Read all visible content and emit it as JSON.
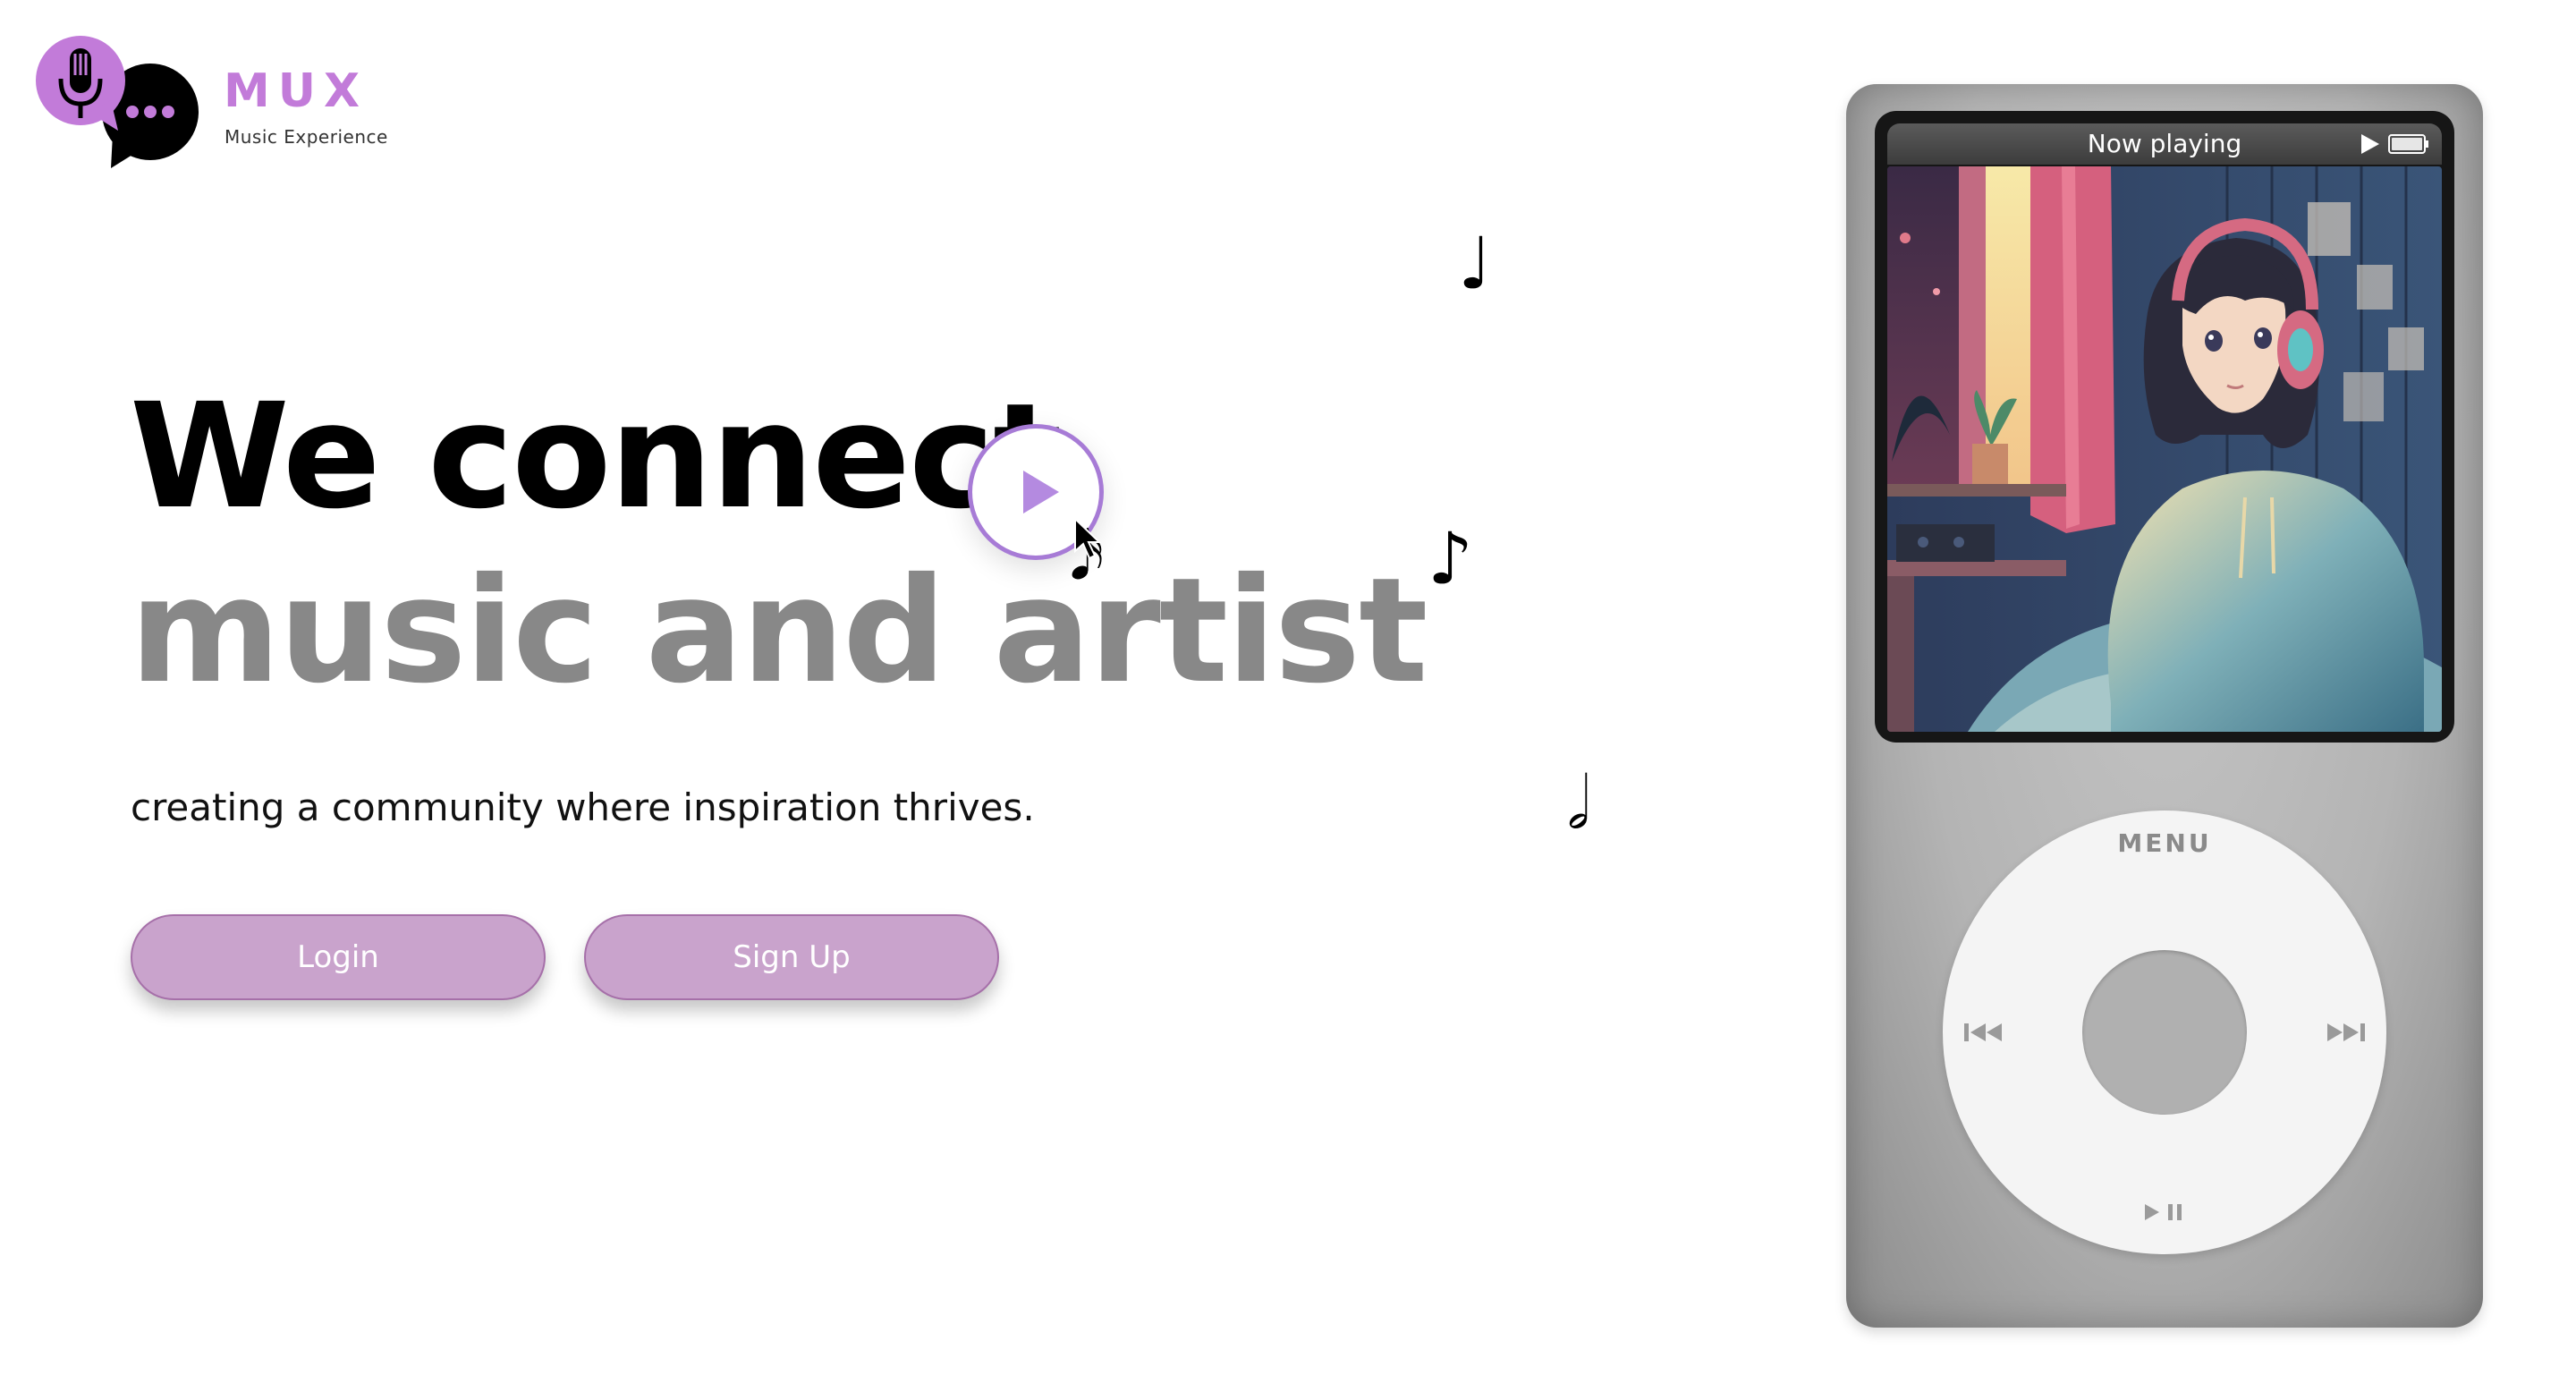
{
  "brand": {
    "name": "MUX",
    "tagline": "Music Experience",
    "accent_color": "#c27bd9"
  },
  "hero": {
    "line1": "We connect",
    "line2": "music and artist",
    "subtitle": "creating a community where inspiration thrives.",
    "play_icon": "play-circle-icon"
  },
  "buttons": {
    "login": "Login",
    "signup": "Sign Up",
    "color": "#c9a3cc"
  },
  "notes": [
    "♩",
    "♪",
    "𝅗𝅥",
    "𝅘𝅥𝅯"
  ],
  "player": {
    "status_title": "Now playing",
    "status_play_icon": "play-icon",
    "battery_icon": "battery-icon",
    "artwork_icon": "album-artwork",
    "menu_label": "MENU",
    "prev_icon": "previous-track-icon",
    "next_icon": "next-track-icon",
    "playpause_icon": "play-pause-icon"
  }
}
